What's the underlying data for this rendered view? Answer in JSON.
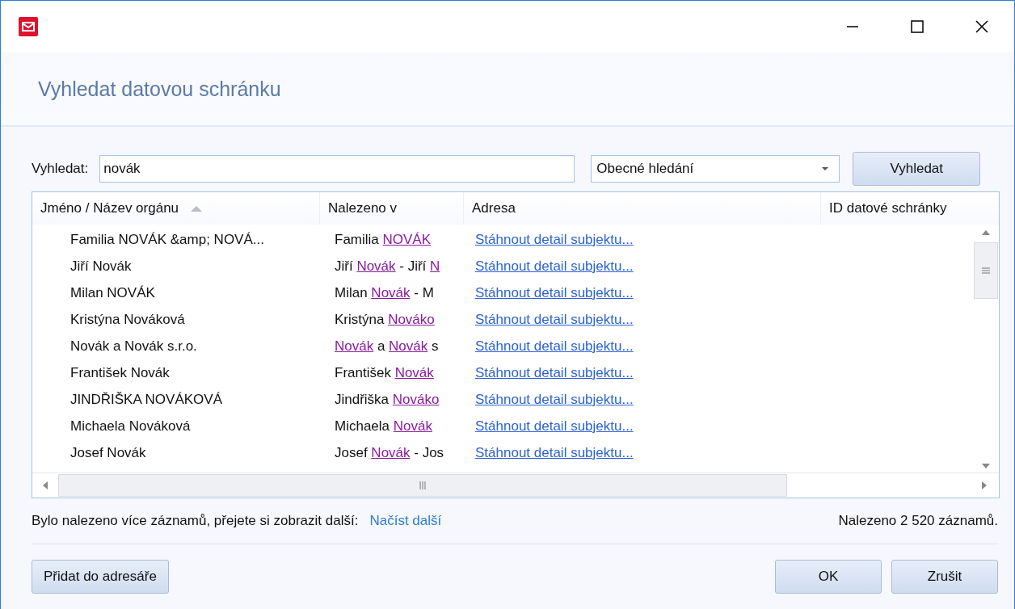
{
  "window": {
    "title": "Vyhledat datovou schránku"
  },
  "search": {
    "label": "Vyhledat:",
    "value": "novák",
    "mode": "Obecné hledání",
    "button": "Vyhledat"
  },
  "table": {
    "columns": [
      {
        "label": "Jméno / Název orgánu",
        "sorted": true
      },
      {
        "label": "Nalezeno v",
        "sorted": false
      },
      {
        "label": "Adresa",
        "sorted": false
      },
      {
        "label": "ID datové schránky",
        "sorted": false
      }
    ],
    "rows": [
      {
        "name": "Familia NOVÁK &amp; NOVÁ...",
        "found": [
          {
            "kind": "plain",
            "text": "Familia "
          },
          {
            "kind": "match",
            "text": "NOVÁK"
          }
        ],
        "address": "Stáhnout detail subjektu..."
      },
      {
        "name": "Jiří Novák",
        "found": [
          {
            "kind": "plain",
            "text": "Jiří "
          },
          {
            "kind": "match",
            "text": "Novák"
          },
          {
            "kind": "plain",
            "text": " - Jiří "
          },
          {
            "kind": "match",
            "text": "N"
          }
        ],
        "address": "Stáhnout detail subjektu..."
      },
      {
        "name": "Milan NOVÁK",
        "found": [
          {
            "kind": "plain",
            "text": "Milan "
          },
          {
            "kind": "match",
            "text": "Novák"
          },
          {
            "kind": "plain",
            "text": " - M"
          }
        ],
        "address": "Stáhnout detail subjektu..."
      },
      {
        "name": "Kristýna Nováková",
        "found": [
          {
            "kind": "plain",
            "text": "Kristýna "
          },
          {
            "kind": "match",
            "text": "Nováko"
          }
        ],
        "address": "Stáhnout detail subjektu..."
      },
      {
        "name": "Novák a Novák s.r.o.",
        "found": [
          {
            "kind": "match",
            "text": "Novák"
          },
          {
            "kind": "plain",
            "text": " a "
          },
          {
            "kind": "match",
            "text": "Novák"
          },
          {
            "kind": "plain",
            "text": " s"
          }
        ],
        "address": "Stáhnout detail subjektu..."
      },
      {
        "name": "František Novák",
        "found": [
          {
            "kind": "plain",
            "text": "František "
          },
          {
            "kind": "match",
            "text": "Novák"
          }
        ],
        "address": "Stáhnout detail subjektu..."
      },
      {
        "name": "JINDŘIŠKA NOVÁKOVÁ",
        "found": [
          {
            "kind": "plain",
            "text": "Jindřiška "
          },
          {
            "kind": "match",
            "text": "Nováko"
          }
        ],
        "address": "Stáhnout detail subjektu..."
      },
      {
        "name": "Michaela Nováková",
        "found": [
          {
            "kind": "plain",
            "text": "Michaela "
          },
          {
            "kind": "match",
            "text": "Novák"
          }
        ],
        "address": "Stáhnout detail subjektu..."
      },
      {
        "name": "Josef Novák",
        "found": [
          {
            "kind": "plain",
            "text": "Josef "
          },
          {
            "kind": "match",
            "text": "Novák"
          },
          {
            "kind": "plain",
            "text": " - Jos"
          }
        ],
        "address": "Stáhnout detail subjektu..."
      }
    ]
  },
  "status": {
    "message": "Bylo nalezeno více záznamů, přejete si zobrazit další:",
    "link": "Načíst další",
    "count": "Nalezeno 2 520 záznamů."
  },
  "buttons": {
    "left": "Přidat do adresáře",
    "ok": "OK",
    "cancel": "Zrušit"
  }
}
